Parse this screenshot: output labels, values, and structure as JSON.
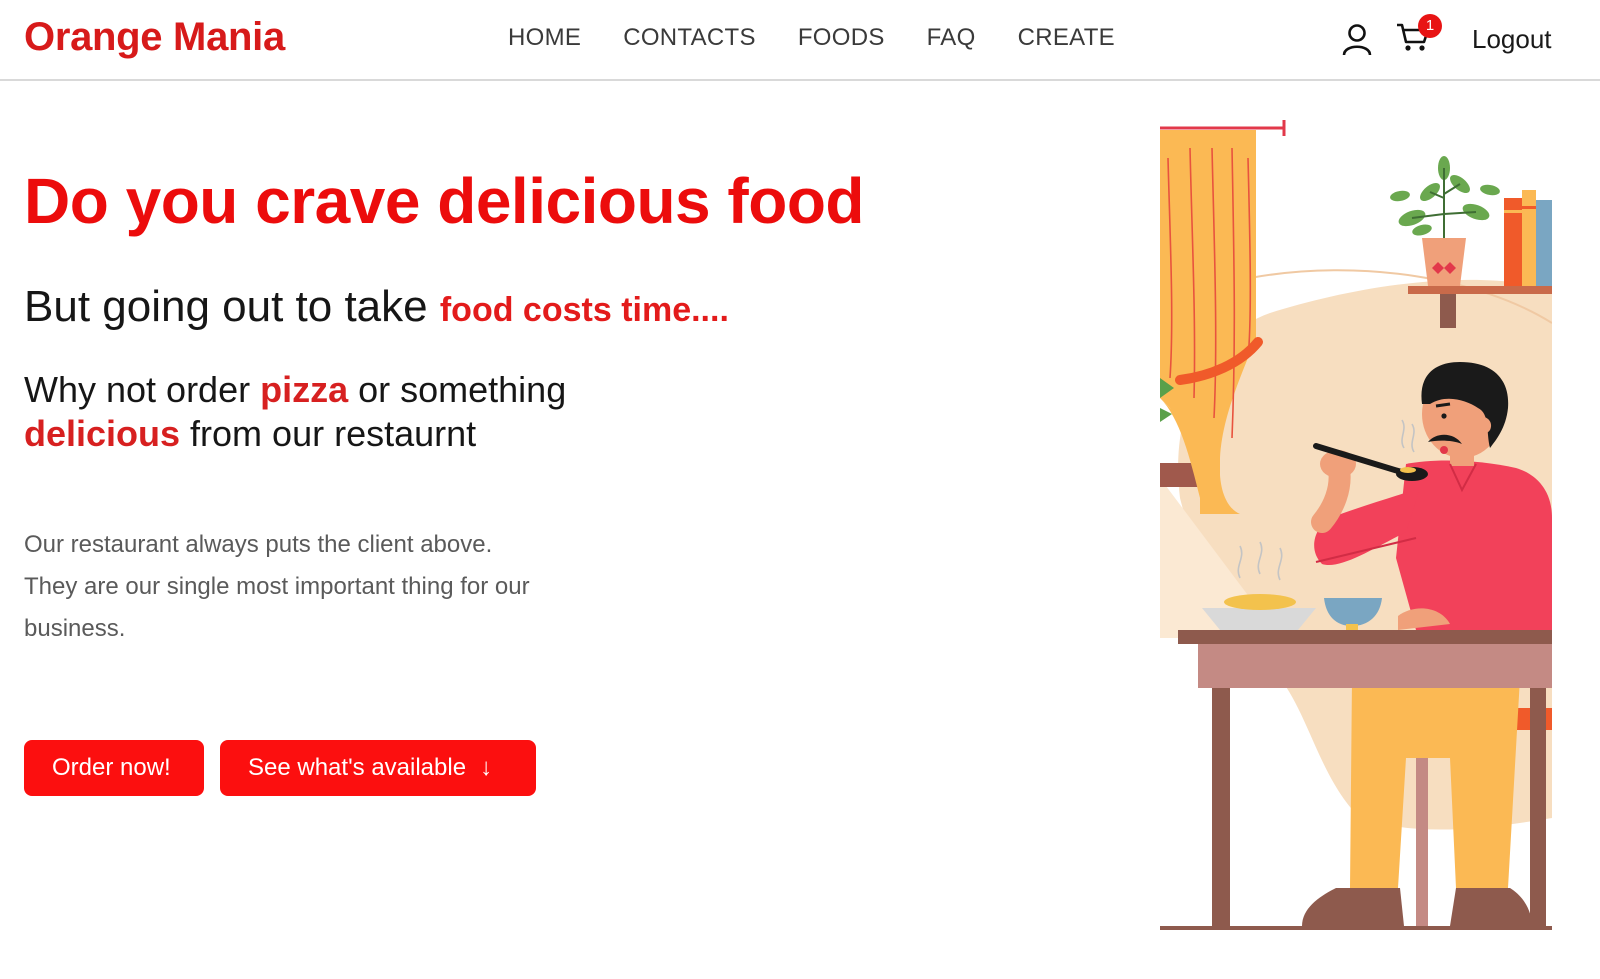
{
  "navbar": {
    "brand": "Orange Mania",
    "links": [
      {
        "label": "HOME"
      },
      {
        "label": "CONTACTS"
      },
      {
        "label": "FOODS"
      },
      {
        "label": "FAQ"
      },
      {
        "label": "CREATE"
      }
    ],
    "cart_count": "1",
    "logout_label": "Logout",
    "icons": {
      "user": "user-icon",
      "cart": "cart-icon"
    }
  },
  "hero": {
    "title": "Do you crave delicious food",
    "line2_prefix": "But going out to take ",
    "line2_highlight": "food costs time....",
    "line3_a": "Why not order ",
    "line3_pizza": "pizza",
    "line3_b": " or something ",
    "line3_delicious": "delicious",
    "line3_c": " from our restaurnt",
    "description": "Our restaurant always puts the client above. They are our single most important thing for our business.",
    "order_button": "Order now!",
    "see_button": "See what's available",
    "see_button_icon": "arrow-down-icon"
  },
  "colors": {
    "brand_red": "#d71a1a",
    "title_red": "#ec0c0c",
    "button_red": "#fc0f0f",
    "curtain": "#fbb954",
    "shirt": "#f2415a"
  }
}
